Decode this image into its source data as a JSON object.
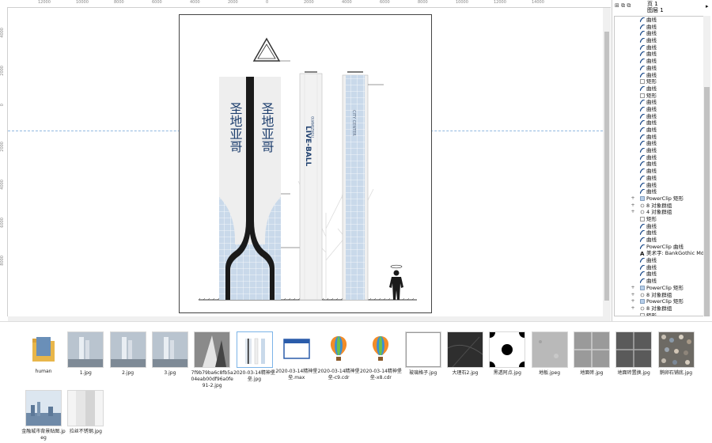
{
  "ruler": {
    "top_labels": [
      "12000",
      "10000",
      "8000",
      "6000",
      "4000",
      "2000",
      "0",
      "2000",
      "4000",
      "6000",
      "8000",
      "10000",
      "12000",
      "14000"
    ],
    "left_labels": [
      "4000",
      "2000",
      "0",
      "2000",
      "4000",
      "6000",
      "8000"
    ]
  },
  "panel": {
    "page_label": "页 1",
    "layer_label": "图层 1",
    "expand_arrow": "▸",
    "rows": [
      {
        "icon": "curve",
        "label": "曲线"
      },
      {
        "icon": "curve",
        "label": "曲线"
      },
      {
        "icon": "curve",
        "label": "曲线"
      },
      {
        "icon": "curve",
        "label": "曲线"
      },
      {
        "icon": "curve",
        "label": "曲线"
      },
      {
        "icon": "curve",
        "label": "曲线"
      },
      {
        "icon": "curve",
        "label": "曲线"
      },
      {
        "icon": "curve",
        "label": "曲线"
      },
      {
        "icon": "curve",
        "label": "曲线"
      },
      {
        "icon": "rect",
        "label": "矩形"
      },
      {
        "icon": "curve",
        "label": "曲线"
      },
      {
        "icon": "rect",
        "label": "矩形"
      },
      {
        "icon": "curve",
        "label": "曲线"
      },
      {
        "icon": "curve",
        "label": "曲线"
      },
      {
        "icon": "curve",
        "label": "曲线"
      },
      {
        "icon": "curve",
        "label": "曲线"
      },
      {
        "icon": "curve",
        "label": "曲线"
      },
      {
        "icon": "curve",
        "label": "曲线"
      },
      {
        "icon": "curve",
        "label": "曲线"
      },
      {
        "icon": "curve",
        "label": "曲线"
      },
      {
        "icon": "curve",
        "label": "曲线"
      },
      {
        "icon": "curve",
        "label": "曲线"
      },
      {
        "icon": "curve",
        "label": "曲线"
      },
      {
        "icon": "curve",
        "label": "曲线"
      },
      {
        "icon": "curve",
        "label": "曲线"
      },
      {
        "icon": "curve",
        "label": "曲线"
      },
      {
        "icon": "powerclip",
        "label": "PowerClip 矩形",
        "expand": "+"
      },
      {
        "icon": "group",
        "label": "8 对象群组",
        "expand": "+"
      },
      {
        "icon": "group",
        "label": "4 对象群组",
        "expand": "+"
      },
      {
        "icon": "rect",
        "label": "矩形"
      },
      {
        "icon": "curve",
        "label": "曲线"
      },
      {
        "icon": "curve",
        "label": "曲线"
      },
      {
        "icon": "curve",
        "label": "曲线"
      },
      {
        "icon": "curve",
        "label": "PowerClip 曲线"
      },
      {
        "icon": "text",
        "label": "美术字: BankGothic Md BT (..."
      },
      {
        "icon": "curve",
        "label": "曲线"
      },
      {
        "icon": "curve",
        "label": "曲线"
      },
      {
        "icon": "curve",
        "label": "曲线"
      },
      {
        "icon": "curve",
        "label": "曲线"
      },
      {
        "icon": "powerclip",
        "label": "PowerClip 矩形",
        "expand": "+"
      },
      {
        "icon": "group",
        "label": "8 对象群组",
        "expand": "+"
      },
      {
        "icon": "powerclip",
        "label": "PowerClip 矩形",
        "expand": "+"
      },
      {
        "icon": "group",
        "label": "8 对象群组",
        "expand": "+"
      },
      {
        "icon": "rect",
        "label": "矩形"
      }
    ]
  },
  "artwork": {
    "tower1_text": "圣地亚哥",
    "tower2_text": "LIVE-BALL",
    "tower2_small": "GUANGZHOU",
    "tower3_text": "CITY CENTER"
  },
  "files": [
    {
      "name": "human",
      "kind": "folder"
    },
    {
      "name": "1.jpg",
      "kind": "photo-city"
    },
    {
      "name": "2.jpg",
      "kind": "photo-city"
    },
    {
      "name": "3.jpg",
      "kind": "photo-city"
    },
    {
      "name": "7f9b79ba6c8fb5a04eab00df96a0fe91-2.jpg",
      "kind": "photo-gray"
    },
    {
      "name": "2020-03-14精神堡垒.jpg",
      "kind": "drawing",
      "selected": true
    },
    {
      "name": "2020-03-14精神堡垒.max",
      "kind": "max"
    },
    {
      "name": "2020-03-14精神堡垒-c9.cdr",
      "kind": "balloon"
    },
    {
      "name": "2020-03-14精神堡垒-x8.cdr",
      "kind": "balloon"
    },
    {
      "name": "玻璃格子.jpg",
      "kind": "blank"
    },
    {
      "name": "大理石2.jpg",
      "kind": "marble-dark"
    },
    {
      "name": "黑透阿点.jpg",
      "kind": "dots"
    },
    {
      "name": "地板.jpeg",
      "kind": "stone-light"
    },
    {
      "name": "地面砖.jpg",
      "kind": "tile"
    },
    {
      "name": "地面砖置换.jpg",
      "kind": "tile-dark"
    },
    {
      "name": "鹅卵石铺底.jpg",
      "kind": "pebble"
    },
    {
      "name": "金融城市背景贴图.jpeg",
      "kind": "skyline"
    },
    {
      "name": "拉丝不锈钢.jpg",
      "kind": "steel"
    }
  ]
}
